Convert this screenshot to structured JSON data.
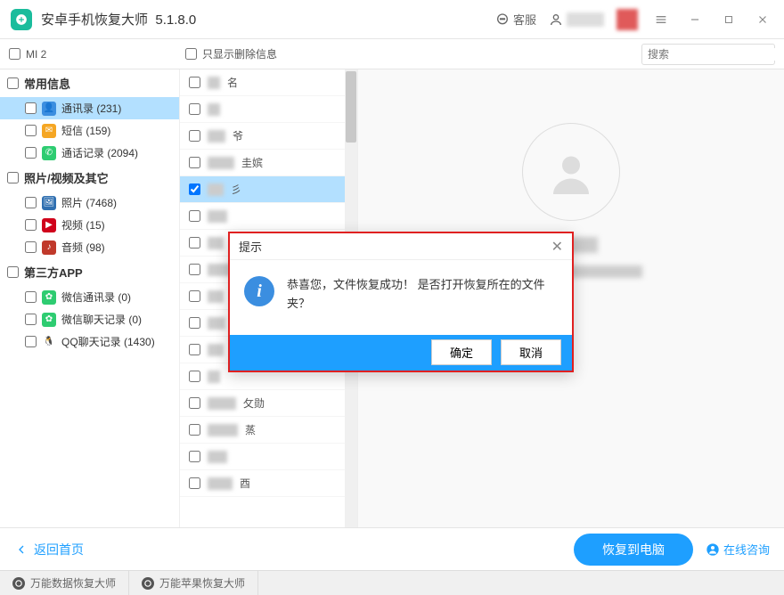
{
  "titlebar": {
    "app_name": "安卓手机恢复大师",
    "version": "5.1.8.0",
    "service_label": "客服"
  },
  "toolbar": {
    "device_label": "MI 2",
    "filter_label": "只显示删除信息",
    "search_placeholder": "搜索"
  },
  "sidebar": {
    "groups": [
      {
        "title": "常用信息",
        "items": [
          {
            "icon_bg": "#3b8ee0",
            "icon_glyph": "👤",
            "label": "通讯录 (231)",
            "selected": true
          },
          {
            "icon_bg": "#f5a623",
            "icon_glyph": "✉",
            "label": "短信 (159)",
            "selected": false
          },
          {
            "icon_bg": "#2ecc71",
            "icon_glyph": "✆",
            "label": "通话记录 (2094)",
            "selected": false
          }
        ]
      },
      {
        "title": "照片/视频及其它",
        "items": [
          {
            "icon_bg": "#2f6fb0",
            "icon_glyph": "🖼",
            "label": "照片 (7468)",
            "selected": false
          },
          {
            "icon_bg": "#d0021b",
            "icon_glyph": "▶",
            "label": "视频 (15)",
            "selected": false
          },
          {
            "icon_bg": "#c0392b",
            "icon_glyph": "♪",
            "label": "音频 (98)",
            "selected": false
          }
        ]
      },
      {
        "title": "第三方APP",
        "items": [
          {
            "icon_bg": "#2ecc71",
            "icon_glyph": "✿",
            "label": "微信通讯录 (0)",
            "selected": false
          },
          {
            "icon_bg": "#2ecc71",
            "icon_glyph": "✿",
            "label": "微信聊天记录 (0)",
            "selected": false
          },
          {
            "icon_bg": "#fff",
            "icon_glyph": "🐧",
            "label": "QQ聊天记录 (1430)",
            "selected": false
          }
        ]
      }
    ]
  },
  "list": {
    "rows": [
      {
        "checked": false,
        "text": "名",
        "w": 14,
        "sel": false
      },
      {
        "checked": false,
        "text": "",
        "w": 14,
        "sel": false
      },
      {
        "checked": false,
        "text": "爷",
        "w": 20,
        "sel": false
      },
      {
        "checked": false,
        "text": "圭嫔",
        "w": 30,
        "sel": false
      },
      {
        "checked": true,
        "text": "彡",
        "w": 18,
        "sel": true
      },
      {
        "checked": false,
        "text": "",
        "w": 22,
        "sel": false
      },
      {
        "checked": false,
        "text": "",
        "w": 18,
        "sel": false
      },
      {
        "checked": false,
        "text": "",
        "w": 26,
        "sel": false
      },
      {
        "checked": false,
        "text": "",
        "w": 18,
        "sel": false
      },
      {
        "checked": false,
        "text": "",
        "w": 20,
        "sel": false
      },
      {
        "checked": false,
        "text": "",
        "w": 18,
        "sel": false
      },
      {
        "checked": false,
        "text": "",
        "w": 14,
        "sel": false
      },
      {
        "checked": false,
        "text": "攵勋",
        "w": 32,
        "sel": false
      },
      {
        "checked": false,
        "text": "蒸",
        "w": 34,
        "sel": false
      },
      {
        "checked": false,
        "text": "",
        "w": 22,
        "sel": false
      },
      {
        "checked": false,
        "text": "酉",
        "w": 28,
        "sel": false
      }
    ]
  },
  "dialog": {
    "title": "提示",
    "message": "恭喜您，文件恢复成功！ 是否打开恢复所在的文件夹？",
    "ok": "确定",
    "cancel": "取消"
  },
  "footer": {
    "back": "返回首页",
    "restore": "恢复到电脑",
    "consult": "在线咨询"
  },
  "bottom_tabs": {
    "tab1": "万能数据恢复大师",
    "tab2": "万能苹果恢复大师"
  }
}
